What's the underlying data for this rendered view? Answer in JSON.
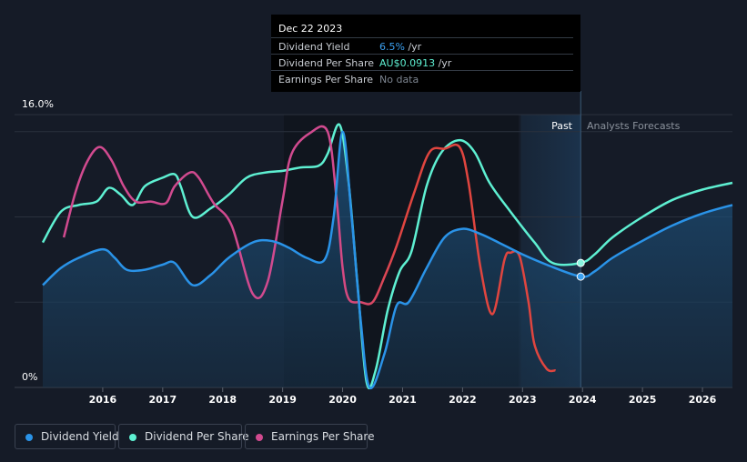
{
  "tooltip": {
    "date": "Dec 22 2023",
    "rows": [
      {
        "label": "Dividend Yield",
        "value": "6.5%",
        "unit": " /yr",
        "color": "#3ba0f0"
      },
      {
        "label": "Dividend Per Share",
        "value": "AU$0.0913",
        "unit": " /yr",
        "color": "#5ef0d2"
      },
      {
        "label": "Earnings Per Share",
        "value": "No data",
        "unit": "",
        "color": "#7d8590"
      }
    ]
  },
  "labels": {
    "past": "Past",
    "forecast": "Analysts Forecasts"
  },
  "legend": [
    {
      "label": "Dividend Yield",
      "color": "#2a93e8"
    },
    {
      "label": "Dividend Per Share",
      "color": "#5ef0d2"
    },
    {
      "label": "Earnings Per Share",
      "color": "#d14a8f"
    }
  ],
  "chart_data": {
    "type": "line",
    "y_tick_labels": [
      "16.0%",
      "0%"
    ],
    "ylim": [
      0,
      16
    ],
    "xlim": [
      2015.0,
      2026.5
    ],
    "x_ticks": [
      2016,
      2017,
      2018,
      2019,
      2020,
      2021,
      2022,
      2023,
      2024,
      2025,
      2026
    ],
    "x_tick_labels": [
      "2016",
      "2017",
      "2018",
      "2019",
      "2020",
      "2021",
      "2022",
      "2023",
      "2024",
      "2025",
      "2026"
    ],
    "forecast_start": 2023.97,
    "past_band_start": 2022.97,
    "highlight_x": 2023.97,
    "series": [
      {
        "name": "Dividend Yield",
        "color": "#2a93e8",
        "fill": true,
        "points": [
          [
            2015.0,
            6.0
          ],
          [
            2015.3,
            7.0
          ],
          [
            2015.6,
            7.6
          ],
          [
            2016.0,
            8.1
          ],
          [
            2016.2,
            7.6
          ],
          [
            2016.4,
            6.9
          ],
          [
            2016.7,
            6.9
          ],
          [
            2017.0,
            7.2
          ],
          [
            2017.2,
            7.3
          ],
          [
            2017.5,
            6.0
          ],
          [
            2017.8,
            6.6
          ],
          [
            2018.1,
            7.6
          ],
          [
            2018.5,
            8.5
          ],
          [
            2018.8,
            8.6
          ],
          [
            2019.1,
            8.2
          ],
          [
            2019.4,
            7.6
          ],
          [
            2019.7,
            7.5
          ],
          [
            2019.85,
            10.0
          ],
          [
            2020.0,
            15.0
          ],
          [
            2020.15,
            10.0
          ],
          [
            2020.3,
            4.0
          ],
          [
            2020.45,
            0.0
          ],
          [
            2020.7,
            2.0
          ],
          [
            2020.9,
            4.8
          ],
          [
            2021.1,
            5.0
          ],
          [
            2021.4,
            7.0
          ],
          [
            2021.7,
            8.8
          ],
          [
            2022.0,
            9.3
          ],
          [
            2022.3,
            9.0
          ],
          [
            2022.6,
            8.5
          ],
          [
            2023.0,
            7.8
          ],
          [
            2023.4,
            7.2
          ],
          [
            2023.97,
            6.5
          ],
          [
            2024.2,
            6.8
          ],
          [
            2024.5,
            7.6
          ],
          [
            2025.0,
            8.6
          ],
          [
            2025.5,
            9.5
          ],
          [
            2026.0,
            10.2
          ],
          [
            2026.5,
            10.7
          ]
        ]
      },
      {
        "name": "Dividend Per Share",
        "color": "#5ef0d2",
        "fill": false,
        "points": [
          [
            2015.0,
            8.5
          ],
          [
            2015.3,
            10.3
          ],
          [
            2015.6,
            10.7
          ],
          [
            2015.9,
            10.9
          ],
          [
            2016.1,
            11.7
          ],
          [
            2016.3,
            11.3
          ],
          [
            2016.5,
            10.7
          ],
          [
            2016.7,
            11.8
          ],
          [
            2017.0,
            12.3
          ],
          [
            2017.2,
            12.5
          ],
          [
            2017.3,
            11.8
          ],
          [
            2017.5,
            10.0
          ],
          [
            2017.8,
            10.5
          ],
          [
            2018.1,
            11.3
          ],
          [
            2018.4,
            12.3
          ],
          [
            2018.7,
            12.6
          ],
          [
            2019.0,
            12.7
          ],
          [
            2019.3,
            12.9
          ],
          [
            2019.6,
            13.0
          ],
          [
            2019.75,
            13.7
          ],
          [
            2019.95,
            15.4
          ],
          [
            2020.1,
            12.0
          ],
          [
            2020.25,
            6.0
          ],
          [
            2020.4,
            0.3
          ],
          [
            2020.55,
            1.0
          ],
          [
            2020.75,
            4.5
          ],
          [
            2020.95,
            6.8
          ],
          [
            2021.15,
            8.0
          ],
          [
            2021.4,
            11.8
          ],
          [
            2021.65,
            13.8
          ],
          [
            2021.95,
            14.5
          ],
          [
            2022.2,
            13.8
          ],
          [
            2022.45,
            12.0
          ],
          [
            2022.8,
            10.3
          ],
          [
            2023.2,
            8.5
          ],
          [
            2023.5,
            7.3
          ],
          [
            2023.97,
            7.3
          ],
          [
            2024.2,
            7.8
          ],
          [
            2024.5,
            8.8
          ],
          [
            2025.0,
            10.0
          ],
          [
            2025.5,
            11.0
          ],
          [
            2026.0,
            11.6
          ],
          [
            2026.5,
            12.0
          ]
        ]
      },
      {
        "name": "Earnings Per Share",
        "color": "#d14a8f",
        "color_end": "#e0453f",
        "fill": false,
        "points": [
          [
            2015.35,
            8.8
          ],
          [
            2015.55,
            11.5
          ],
          [
            2015.75,
            13.3
          ],
          [
            2015.95,
            14.1
          ],
          [
            2016.15,
            13.3
          ],
          [
            2016.35,
            11.8
          ],
          [
            2016.55,
            10.9
          ],
          [
            2016.8,
            10.9
          ],
          [
            2017.05,
            10.8
          ],
          [
            2017.2,
            11.8
          ],
          [
            2017.45,
            12.6
          ],
          [
            2017.6,
            12.3
          ],
          [
            2017.85,
            10.8
          ],
          [
            2018.15,
            9.5
          ],
          [
            2018.5,
            5.5
          ],
          [
            2018.75,
            6.2
          ],
          [
            2019.0,
            11.0
          ],
          [
            2019.15,
            13.7
          ],
          [
            2019.45,
            14.9
          ],
          [
            2019.75,
            15.0
          ],
          [
            2019.9,
            11.0
          ],
          [
            2020.0,
            7.0
          ],
          [
            2020.1,
            5.2
          ],
          [
            2020.3,
            5.0
          ],
          [
            2020.5,
            5.0
          ],
          [
            2020.7,
            6.5
          ],
          [
            2020.9,
            8.3
          ],
          [
            2021.2,
            11.5
          ],
          [
            2021.45,
            13.8
          ],
          [
            2021.7,
            14.0
          ],
          [
            2021.95,
            14.1
          ],
          [
            2022.1,
            12.0
          ],
          [
            2022.3,
            7.0
          ],
          [
            2022.5,
            4.3
          ],
          [
            2022.7,
            7.5
          ],
          [
            2022.8,
            7.9
          ],
          [
            2022.95,
            7.7
          ],
          [
            2023.1,
            5.0
          ],
          [
            2023.2,
            2.5
          ],
          [
            2023.4,
            1.1
          ],
          [
            2023.55,
            1.0
          ]
        ]
      }
    ],
    "highlight_points": [
      {
        "series": "Dividend Per Share",
        "x": 2023.97,
        "y": 7.3
      },
      {
        "series": "Dividend Yield",
        "x": 2023.97,
        "y": 6.5
      }
    ]
  }
}
